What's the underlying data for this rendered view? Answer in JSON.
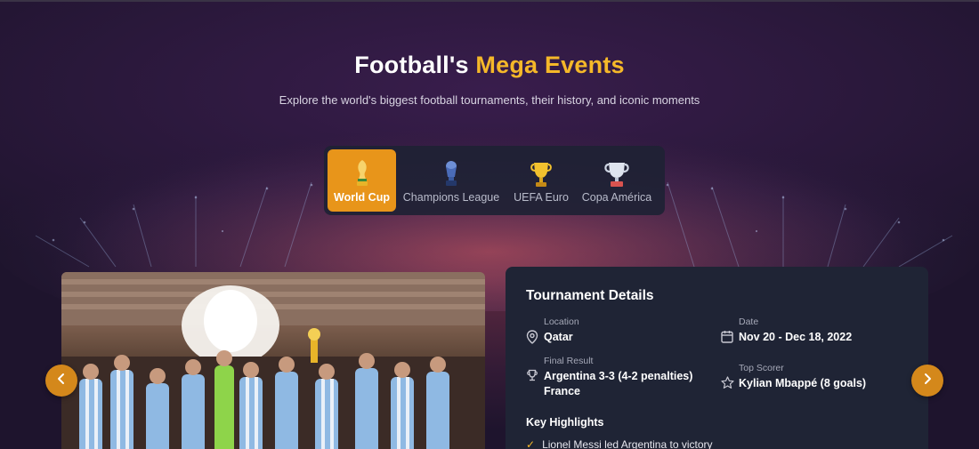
{
  "header": {
    "title_main": "Football's",
    "title_accent": "Mega Events",
    "subtitle": "Explore the world's biggest football tournaments, their history, and iconic moments"
  },
  "tabs": [
    {
      "label": "World Cup",
      "icon": "world-cup-trophy-icon",
      "active": true
    },
    {
      "label": "Champions League",
      "icon": "champions-league-trophy-icon",
      "active": false
    },
    {
      "label": "UEFA Euro",
      "icon": "euro-trophy-icon",
      "active": false
    },
    {
      "label": "Copa América",
      "icon": "copa-america-trophy-icon",
      "active": false
    }
  ],
  "details": {
    "title": "Tournament Details",
    "location_label": "Location",
    "location_value": "Qatar",
    "date_label": "Date",
    "date_value": "Nov 20 - Dec 18, 2022",
    "final_label": "Final Result",
    "final_value_1": "Argentina 3-3 (4-2 penalties)",
    "final_value_2": "France",
    "scorer_label": "Top Scorer",
    "scorer_value": "Kylian Mbappé (8 goals)",
    "highlights_title": "Key Highlights",
    "highlights": [
      "Lionel Messi led Argentina to victory"
    ]
  },
  "colors": {
    "accent": "#f5b829",
    "active_tab": "#e8951a",
    "nav_button": "#d4881b",
    "panel": "#1f2435"
  },
  "icons": {
    "prev": "chevron-left-icon",
    "next": "chevron-right-icon",
    "location": "map-pin-icon",
    "date": "calendar-icon",
    "final": "trophy-icon",
    "scorer": "star-icon",
    "highlight": "check-icon"
  }
}
